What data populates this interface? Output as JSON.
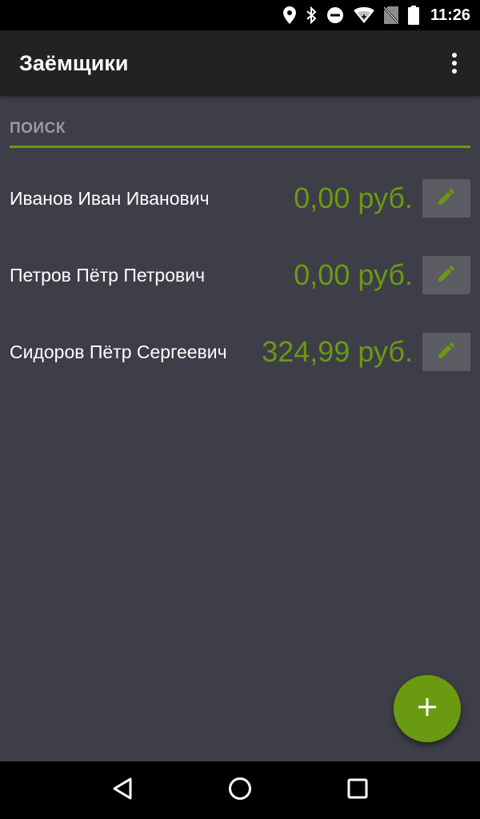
{
  "status_bar": {
    "time": "11:26",
    "icons": [
      "location-icon",
      "bluetooth-icon",
      "do-not-disturb-icon",
      "wifi-icon",
      "no-sim-icon",
      "battery-icon"
    ]
  },
  "app_bar": {
    "title": "Заёмщики",
    "menu_icon": "more-vert-icon"
  },
  "search": {
    "placeholder": "ПОИСК",
    "value": ""
  },
  "borrowers": [
    {
      "name": "Иванов Иван Иванович",
      "amount": "0,00 руб."
    },
    {
      "name": "Петров Пётр Петрович",
      "amount": "0,00 руб."
    },
    {
      "name": "Сидоров Пётр Сергеевич",
      "amount": "324,99 руб."
    }
  ],
  "fab": {
    "icon": "add-icon"
  },
  "nav_bar": {
    "buttons": [
      "back-icon",
      "home-icon",
      "recents-icon"
    ]
  },
  "colors": {
    "accent": "#6a9a10",
    "background": "#3e3e48",
    "app_bar": "#222222",
    "edit_button": "#5c5c63"
  }
}
